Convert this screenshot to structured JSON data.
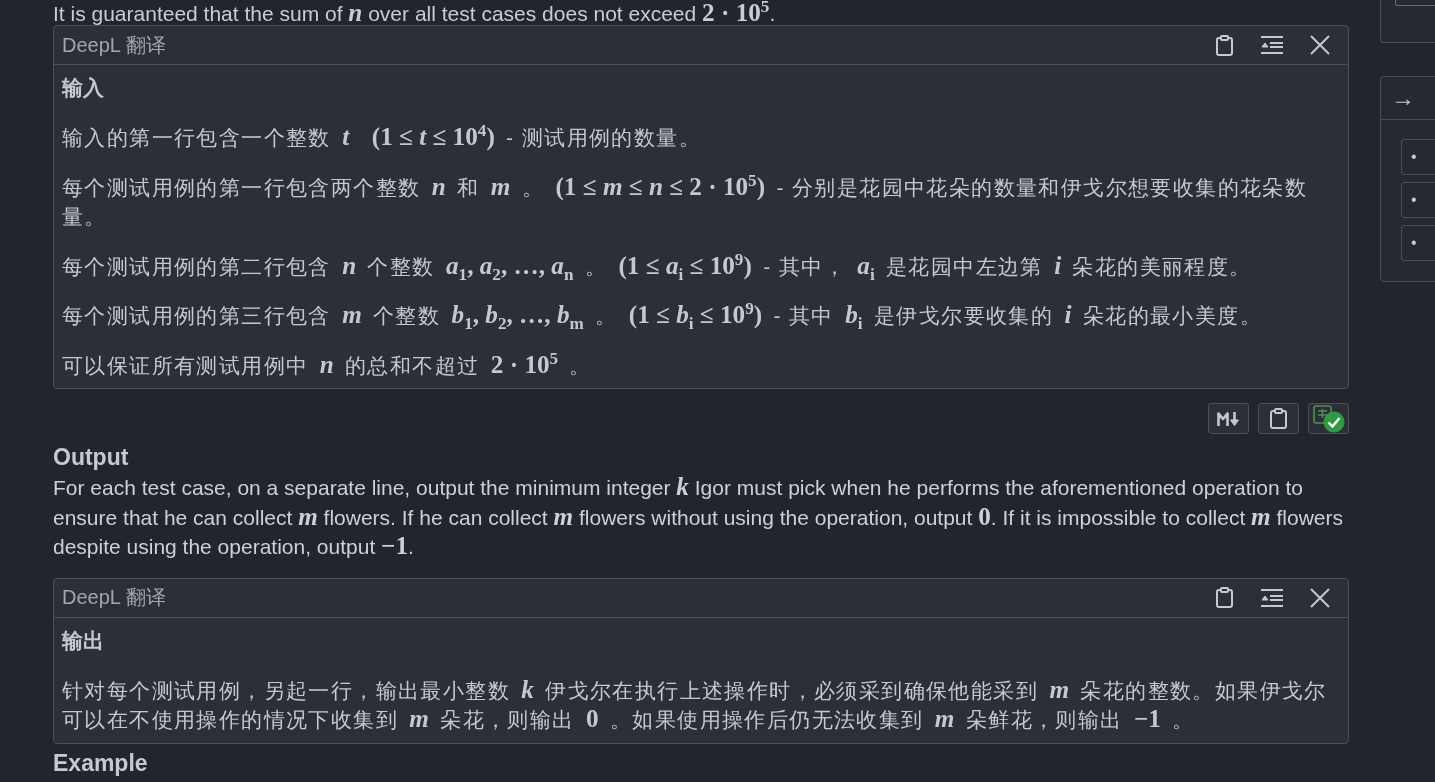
{
  "statement_tail": {
    "segments": [
      {
        "kind": "text",
        "text": "It is guaranteed that the sum of "
      },
      {
        "kind": "math",
        "text": "*n*"
      },
      {
        "kind": "text",
        "text": " over all test cases does not exceed "
      },
      {
        "kind": "math",
        "text": "2 · 10$^{5}$"
      },
      {
        "kind": "text",
        "text": "."
      }
    ]
  },
  "input_translation": {
    "provider": "DeepL 翻译",
    "heading": "输入",
    "paragraphs": [
      {
        "segments": [
          {
            "kind": "text",
            "text": "输入的第一行包含一个整数"
          },
          {
            "kind": "math",
            "text": "*t*"
          },
          {
            "kind": "math",
            "text": "(1 ≤ *t* ≤ 10$^{4}$)"
          },
          {
            "kind": "text",
            "text": "- 测试用例的数量。"
          }
        ]
      },
      {
        "segments": [
          {
            "kind": "text",
            "text": "每个测试用例的第一行包含两个整数"
          },
          {
            "kind": "math",
            "text": "*n*"
          },
          {
            "kind": "text",
            "text": "和"
          },
          {
            "kind": "math",
            "text": "*m*"
          },
          {
            "kind": "text",
            "text": "。"
          },
          {
            "kind": "math",
            "text": "(1 ≤ *m* ≤ *n* ≤ 2 · 10$^{5}$)"
          },
          {
            "kind": "text",
            "text": "- 分别是花园中花朵的数量和伊戈尔想要收集的花朵数量。"
          }
        ]
      },
      {
        "segments": [
          {
            "kind": "text",
            "text": "每个测试用例的第二行包含"
          },
          {
            "kind": "math",
            "text": "*n*"
          },
          {
            "kind": "text",
            "text": "个整数"
          },
          {
            "kind": "math",
            "text": "*a*$_{1}$, *a*$_{2}$, …, *a*$_{n}$"
          },
          {
            "kind": "text",
            "text": "。"
          },
          {
            "kind": "math",
            "text": "(1 ≤ *a*$_{i}$ ≤ 10$^{9}$)"
          },
          {
            "kind": "text",
            "text": "- 其中，"
          },
          {
            "kind": "math",
            "text": "*a*$_{i}$"
          },
          {
            "kind": "text",
            "text": "是花园中左边第"
          },
          {
            "kind": "math",
            "text": "*i*"
          },
          {
            "kind": "text",
            "text": "朵花的美丽程度。"
          }
        ]
      },
      {
        "segments": [
          {
            "kind": "text",
            "text": "每个测试用例的第三行包含"
          },
          {
            "kind": "math",
            "text": "*m*"
          },
          {
            "kind": "text",
            "text": "个整数"
          },
          {
            "kind": "math",
            "text": "*b*$_{1}$, *b*$_{2}$, …, *b*$_{m}$"
          },
          {
            "kind": "text",
            "text": "。"
          },
          {
            "kind": "math",
            "text": "(1 ≤ *b*$_{i}$ ≤ 10$^{9}$)"
          },
          {
            "kind": "text",
            "text": "- 其中"
          },
          {
            "kind": "math",
            "text": "*b*$_{i}$"
          },
          {
            "kind": "text",
            "text": "是伊戈尔要收集的"
          },
          {
            "kind": "math",
            "text": "*i*"
          },
          {
            "kind": "text",
            "text": "朵花的最小美度。"
          }
        ]
      },
      {
        "segments": [
          {
            "kind": "text",
            "text": "可以保证所有测试用例中"
          },
          {
            "kind": "math",
            "text": "*n*"
          },
          {
            "kind": "text",
            "text": "的总和不超过"
          },
          {
            "kind": "math",
            "text": "2 · 10$^{5}$"
          },
          {
            "kind": "text",
            "text": "。"
          }
        ]
      }
    ]
  },
  "output_section": {
    "heading": "Output",
    "paragraphs": [
      {
        "segments": [
          {
            "kind": "text",
            "text": "For each test case, on a separate line, output the minimum integer "
          },
          {
            "kind": "math",
            "text": "*k*"
          },
          {
            "kind": "text",
            "text": " Igor must pick when he performs the aforementioned operation to ensure that he can collect "
          },
          {
            "kind": "math",
            "text": "*m*"
          },
          {
            "kind": "text",
            "text": " flowers. If he can collect "
          },
          {
            "kind": "math",
            "text": "*m*"
          },
          {
            "kind": "text",
            "text": " flowers without using the operation, output "
          },
          {
            "kind": "math",
            "text": "0"
          },
          {
            "kind": "text",
            "text": ". If it is impossible to collect "
          },
          {
            "kind": "math",
            "text": "*m*"
          },
          {
            "kind": "text",
            "text": " flowers despite using the operation, output "
          },
          {
            "kind": "math",
            "text": "−1"
          },
          {
            "kind": "text",
            "text": "."
          }
        ]
      }
    ]
  },
  "output_translation": {
    "provider": "DeepL 翻译",
    "heading": "输出",
    "paragraphs": [
      {
        "segments": [
          {
            "kind": "text",
            "text": "针对每个测试用例，另起一行，输出最小整数"
          },
          {
            "kind": "math",
            "text": "*k*"
          },
          {
            "kind": "text",
            "text": "伊戈尔在执行上述操作时，必须采到确保他能采到"
          },
          {
            "kind": "math",
            "text": "*m*"
          },
          {
            "kind": "text",
            "text": "朵花的整数。如果伊戈尔可以在不使用操作的情况下收集到"
          },
          {
            "kind": "math",
            "text": "*m*"
          },
          {
            "kind": "text",
            "text": "朵花，则输出"
          },
          {
            "kind": "math",
            "text": "0"
          },
          {
            "kind": "text",
            "text": "。如果使用操作后仍无法收集到"
          },
          {
            "kind": "math",
            "text": "*m*"
          },
          {
            "kind": "text",
            "text": "朵鲜花，则输出"
          },
          {
            "kind": "math",
            "text": "−1"
          },
          {
            "kind": "text",
            "text": "。"
          }
        ]
      }
    ]
  },
  "next_section": {
    "heading": "Example"
  },
  "sidebar": {
    "panel": {
      "title": "→",
      "items": [
        {
          "marker": "•"
        },
        {
          "marker": "•"
        },
        {
          "marker": "•"
        }
      ]
    }
  }
}
